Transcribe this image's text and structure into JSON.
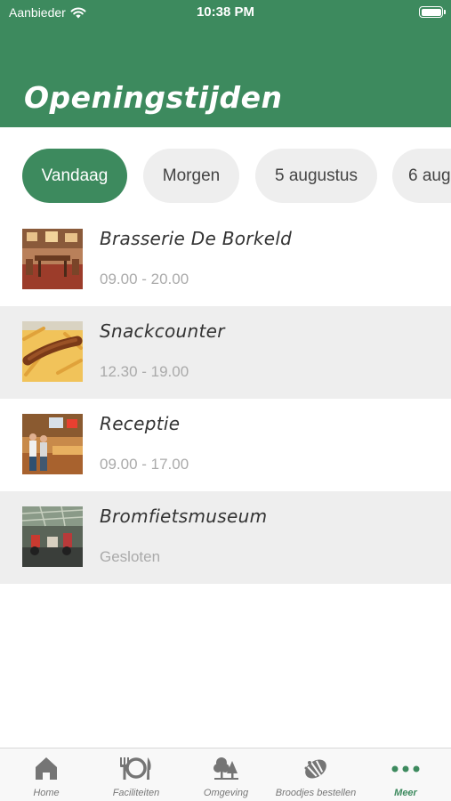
{
  "status_bar": {
    "carrier": "Aanbieder",
    "time": "10:38 PM"
  },
  "header": {
    "title": "Openingstijden",
    "background_color": "#3d8a5e"
  },
  "day_tabs": [
    {
      "label": "Vandaag",
      "selected": true
    },
    {
      "label": "Morgen",
      "selected": false
    },
    {
      "label": "5 augustus",
      "selected": false
    },
    {
      "label": "6 aug",
      "selected": false
    }
  ],
  "locations": [
    {
      "name": "Brasserie De Borkeld",
      "hours": "09.00 - 20.00",
      "image": "restaurant-interior-photo"
    },
    {
      "name": "Snackcounter",
      "hours": "12.30 - 19.00",
      "image": "fries-snack-photo"
    },
    {
      "name": "Receptie",
      "hours": "09.00 - 17.00",
      "image": "reception-desk-photo"
    },
    {
      "name": "Bromfietsmuseum",
      "hours": "Gesloten",
      "image": "museum-interior-photo"
    }
  ],
  "tabbar": {
    "items": [
      {
        "label": "Home",
        "icon": "house-icon",
        "active": false
      },
      {
        "label": "Faciliteiten",
        "icon": "cutlery-icon",
        "active": false
      },
      {
        "label": "Omgeving",
        "icon": "trees-icon",
        "active": false
      },
      {
        "label": "Broodjes bestellen",
        "icon": "bread-icon",
        "active": false
      },
      {
        "label": "Meer",
        "icon": "more-dots-icon",
        "active": true
      }
    ]
  }
}
